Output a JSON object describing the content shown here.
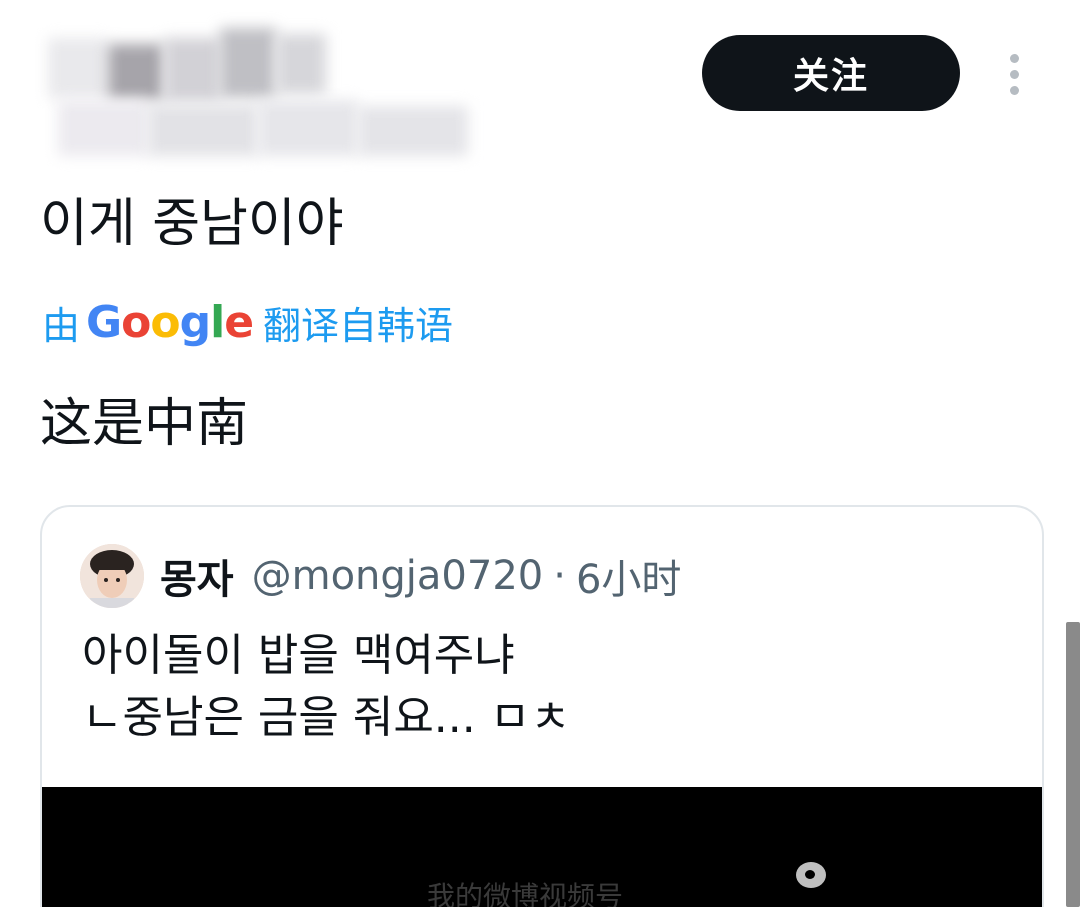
{
  "header": {
    "follow_label": "关注"
  },
  "tweet": {
    "text": "이게 중남이야",
    "translate_prefix": "由",
    "translate_brand": "Google",
    "translate_suffix": "翻译自韩语",
    "translated_text": "这是中南"
  },
  "quote": {
    "name": "몽자",
    "handle": "@mongja0720",
    "separator": "·",
    "time": "6小时",
    "lines": [
      "아이돌이 밥을 맥여주냐",
      "ㄴ중남은  금을 줘요... ㅁㅊ"
    ],
    "media_watermark": "我的微博视频号"
  },
  "colors": {
    "accent": "#1d9bf0",
    "follow_bg": "#0f1419",
    "muted_text": "#536471"
  }
}
